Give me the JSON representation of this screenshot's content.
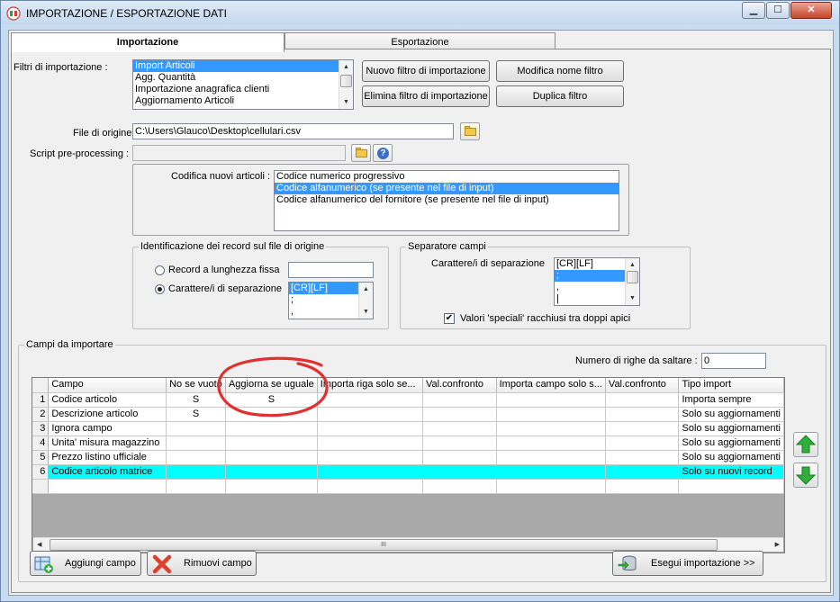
{
  "window": {
    "title": "IMPORTAZIONE / ESPORTAZIONE DATI",
    "controls": {
      "minimize": "▁",
      "maximize": "☐",
      "close": "✕"
    }
  },
  "tabs": [
    {
      "label": "Importazione",
      "active": true
    },
    {
      "label": "Esportazione",
      "active": false
    }
  ],
  "filters": {
    "label": "Filtri di importazione :",
    "items": [
      "Import Articoli",
      "Agg. Quantità",
      "Importazione anagrafica clienti",
      "Aggiornamento Articoli"
    ],
    "selected": 0,
    "buttons": {
      "new": "Nuovo filtro di importazione",
      "rename": "Modifica nome filtro",
      "delete": "Elimina filtro di importazione",
      "duplicate": "Duplica filtro"
    }
  },
  "source_file": {
    "label": "File di origine :",
    "value": "C:\\Users\\Glauco\\Desktop\\cellulari.csv"
  },
  "script": {
    "label": "Script pre-processing :",
    "value": ""
  },
  "coding": {
    "label": "Codifica nuovi articoli :",
    "items": [
      "Codice numerico progressivo",
      "Codice alfanumerico (se presente nel file di input)",
      "Codice alfanumerico del fornitore (se presente nel file di input)"
    ],
    "selected": 1
  },
  "record_id": {
    "title": "Identificazione dei record sul file di origine",
    "fixed_length_label": "Record a lunghezza fissa",
    "fixed_length_value": "",
    "separator_label": "Carattere/i di separazione",
    "separator_selected": true,
    "separator_items": [
      "[CR][LF]",
      ";",
      ","
    ],
    "separator_selected_index": 0
  },
  "field_separator": {
    "title": "Separatore campi",
    "label": "Carattere/i di separazione",
    "items": [
      "[CR][LF]",
      ";",
      ",",
      "|"
    ],
    "selected": 1,
    "quotes_label": "Valori 'speciali' racchiusi tra doppi apici",
    "quotes_checked": true,
    "check_mark": "✔"
  },
  "fields": {
    "title": "Campi da importare",
    "skip_rows_label": "Numero di righe da saltare :",
    "skip_rows_value": "0",
    "columns": [
      "Campo",
      "No se vuoto",
      "Aggiorna se uguale",
      "Importa riga solo se...",
      "Val.confronto",
      "Importa campo solo s...",
      "Val.confronto",
      "Tipo import"
    ],
    "rows": [
      {
        "num": "1",
        "campo": "Codice articolo",
        "no_vuoto": "S",
        "aggiorna": "S",
        "riga_se": "",
        "val1": "",
        "campo_se": "",
        "val2": "",
        "tipo": "Importa sempre"
      },
      {
        "num": "2",
        "campo": "Descrizione articolo",
        "no_vuoto": "S",
        "aggiorna": "",
        "riga_se": "",
        "val1": "",
        "campo_se": "",
        "val2": "",
        "tipo": "Solo su aggiornamenti"
      },
      {
        "num": "3",
        "campo": "Ignora campo",
        "no_vuoto": "",
        "aggiorna": "",
        "riga_se": "",
        "val1": "",
        "campo_se": "",
        "val2": "",
        "tipo": "Solo su aggiornamenti"
      },
      {
        "num": "4",
        "campo": "Unita' misura magazzino",
        "no_vuoto": "",
        "aggiorna": "",
        "riga_se": "",
        "val1": "",
        "campo_se": "",
        "val2": "",
        "tipo": "Solo su aggiornamenti"
      },
      {
        "num": "5",
        "campo": "Prezzo listino ufficiale",
        "no_vuoto": "",
        "aggiorna": "",
        "riga_se": "",
        "val1": "",
        "campo_se": "",
        "val2": "",
        "tipo": "Solo su aggiornamenti"
      },
      {
        "num": "6",
        "campo": "Codice articolo matrice",
        "no_vuoto": "",
        "aggiorna": "",
        "riga_se": "",
        "val1": "",
        "campo_se": "",
        "val2": "",
        "tipo": "Solo su nuovi record"
      }
    ],
    "highlighted_row": 5,
    "hscroll_grip": "III"
  },
  "buttons": {
    "add_field": "Aggiungi campo",
    "remove_field": "Rimuovi campo",
    "run_import": "Esegui importazione >>"
  },
  "colors": {
    "selection": "#3399ff",
    "highlight_row": "#00ffff",
    "annotation": "#e03030",
    "arrow_green": "#2fae3a"
  }
}
